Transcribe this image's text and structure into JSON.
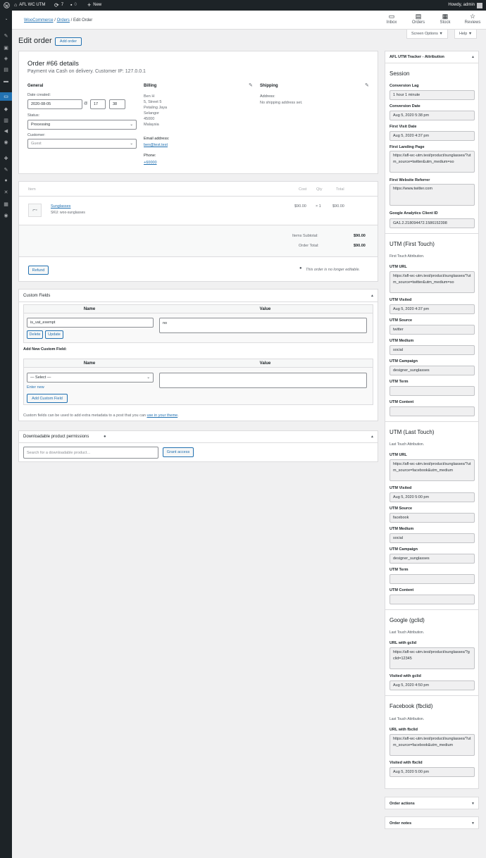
{
  "admin_bar": {
    "site_name": "AFL WC UTM",
    "updates_count": "7",
    "comments_count": "0",
    "new_label": "New",
    "howdy": "Howdy, admin"
  },
  "breadcrumb": {
    "woocommerce": "WooCommerce",
    "orders": "Orders",
    "current": "Edit Order"
  },
  "top_icons": [
    {
      "label": "Inbox",
      "icon": "inbox-icon"
    },
    {
      "label": "Orders",
      "icon": "orders-icon"
    },
    {
      "label": "Stock",
      "icon": "stock-icon"
    },
    {
      "label": "Reviews",
      "icon": "reviews-icon"
    }
  ],
  "screen_options": "Screen Options ▼",
  "help": "Help ▼",
  "page": {
    "title": "Edit order",
    "add_order": "Add order"
  },
  "order": {
    "heading": "Order #66 details",
    "subheading": "Payment via Cash on delivery. Customer IP: 127.0.0.1",
    "general": {
      "title": "General",
      "date_label": "Date created:",
      "date": "2020-08-05",
      "at": "@",
      "hour": "17",
      "minute": "38",
      "status_label": "Status:",
      "status": "Processing",
      "customer_label": "Customer:",
      "customer": "Guest"
    },
    "billing": {
      "title": "Billing",
      "address_lines": [
        "Ben H",
        "5, Street 5",
        "Petaling Jaya",
        "Selangor",
        "45000",
        "Malaysia"
      ],
      "email_label": "Email address:",
      "email": "ben@test.test",
      "phone_label": "Phone:",
      "phone": "+60000"
    },
    "shipping": {
      "title": "Shipping",
      "address_label": "Address:",
      "address": "No shipping address set."
    }
  },
  "items": {
    "headers": {
      "item": "Item",
      "cost": "Cost",
      "qty": "Qty",
      "total": "Total"
    },
    "rows": [
      {
        "name": "Sunglasses",
        "sku": "SKU: woo-sunglasses",
        "cost": "$90.00",
        "qty": "× 1",
        "total": "$90.00"
      }
    ],
    "subtotal_label": "Items Subtotal:",
    "subtotal": "$90.00",
    "order_total_label": "Order Total:",
    "order_total": "$90.00",
    "refund": "Refund",
    "not_editable": "This order is no longer editable."
  },
  "custom_fields": {
    "title": "Custom Fields",
    "name_header": "Name",
    "value_header": "Value",
    "meta_name": "is_vat_exempt",
    "meta_value": "no",
    "delete": "Delete",
    "update": "Update",
    "add_new_label": "Add New Custom Field:",
    "select_placeholder": "— Select —",
    "enter_new": "Enter new",
    "add_button": "Add Custom Field",
    "note_prefix": "Custom fields can be used to add extra metadata to a post that you can",
    "note_link": "use in your theme",
    "note_suffix": "."
  },
  "downloads": {
    "title": "Downloadable product permissions",
    "search_placeholder": "Search for a downloadable product…",
    "grant": "Grant access"
  },
  "utm": {
    "title": "AFL UTM Tracker - Attribution",
    "session": {
      "heading": "Session",
      "conversion_lag_label": "Conversion Lag",
      "conversion_lag": "1 hour 1 minute",
      "conversion_date_label": "Conversion Date",
      "conversion_date": "Aug 5, 2020 5:38 pm",
      "first_visit_label": "First Visit Date",
      "first_visit": "Aug 5, 2020 4:37 pm",
      "landing_label": "First Landing Page",
      "landing": "https://afl-wc-utm.test/product/sunglasses/?utm_source=twitter&utm_medium=so",
      "referrer_label": "First Website Referrer",
      "referrer": "https://www.twitter.com",
      "ga_label": "Google Analytics Client ID",
      "ga": "GA1.2.218094472.1586152398"
    },
    "first_touch": {
      "heading": "UTM (First Touch)",
      "desc": "First Touch Attribution.",
      "url_label": "UTM URL",
      "url": "https://afl-wc-utm.test/product/sunglasses/?utm_source=twitter&utm_medium=so",
      "visited_label": "UTM Visited",
      "visited": "Aug 5, 2020 4:37 pm",
      "source_label": "UTM Source",
      "source": "twitter",
      "medium_label": "UTM Medium",
      "medium": "social",
      "campaign_label": "UTM Campaign",
      "campaign": "designer_sunglasses",
      "term_label": "UTM Term",
      "term": "",
      "content_label": "UTM Content",
      "content": ""
    },
    "last_touch": {
      "heading": "UTM (Last Touch)",
      "desc": "Last Touch Attribution.",
      "url_label": "UTM URL",
      "url": "https://afl-wc-utm.test/product/sunglasses/?utm_source=facebook&utm_medium",
      "visited_label": "UTM Visited",
      "visited": "Aug 5, 2020 5:00 pm",
      "source_label": "UTM Source",
      "source": "facebook",
      "medium_label": "UTM Medium",
      "medium": "social",
      "campaign_label": "UTM Campaign",
      "campaign": "designer_sunglasses",
      "term_label": "UTM Term",
      "term": "",
      "content_label": "UTM Content",
      "content": ""
    },
    "gclid": {
      "heading": "Google (gclid)",
      "desc": "Last Touch Attribution.",
      "url_label": "URL with gclid",
      "url": "https://afl-wc-utm.test/product/sunglasses/?gclid=12345",
      "visited_label": "Visited with gclid",
      "visited": "Aug 5, 2020 4:50 pm"
    },
    "fbclid": {
      "heading": "Facebook (fbclid)",
      "desc": "Last Touch Attribution.",
      "url_label": "URL with fbclid",
      "url": "https://afl-wc-utm.test/product/sunglasses/?utm_source=facebook&utm_medium",
      "visited_label": "Visited with fbclid",
      "visited": "Aug 5, 2020 5:00 pm"
    }
  },
  "order_actions": "Order actions",
  "order_notes": "Order notes",
  "colors": {
    "admin_bar": "#1d2327",
    "accent": "#2271b1",
    "background": "#f0f0f1"
  }
}
